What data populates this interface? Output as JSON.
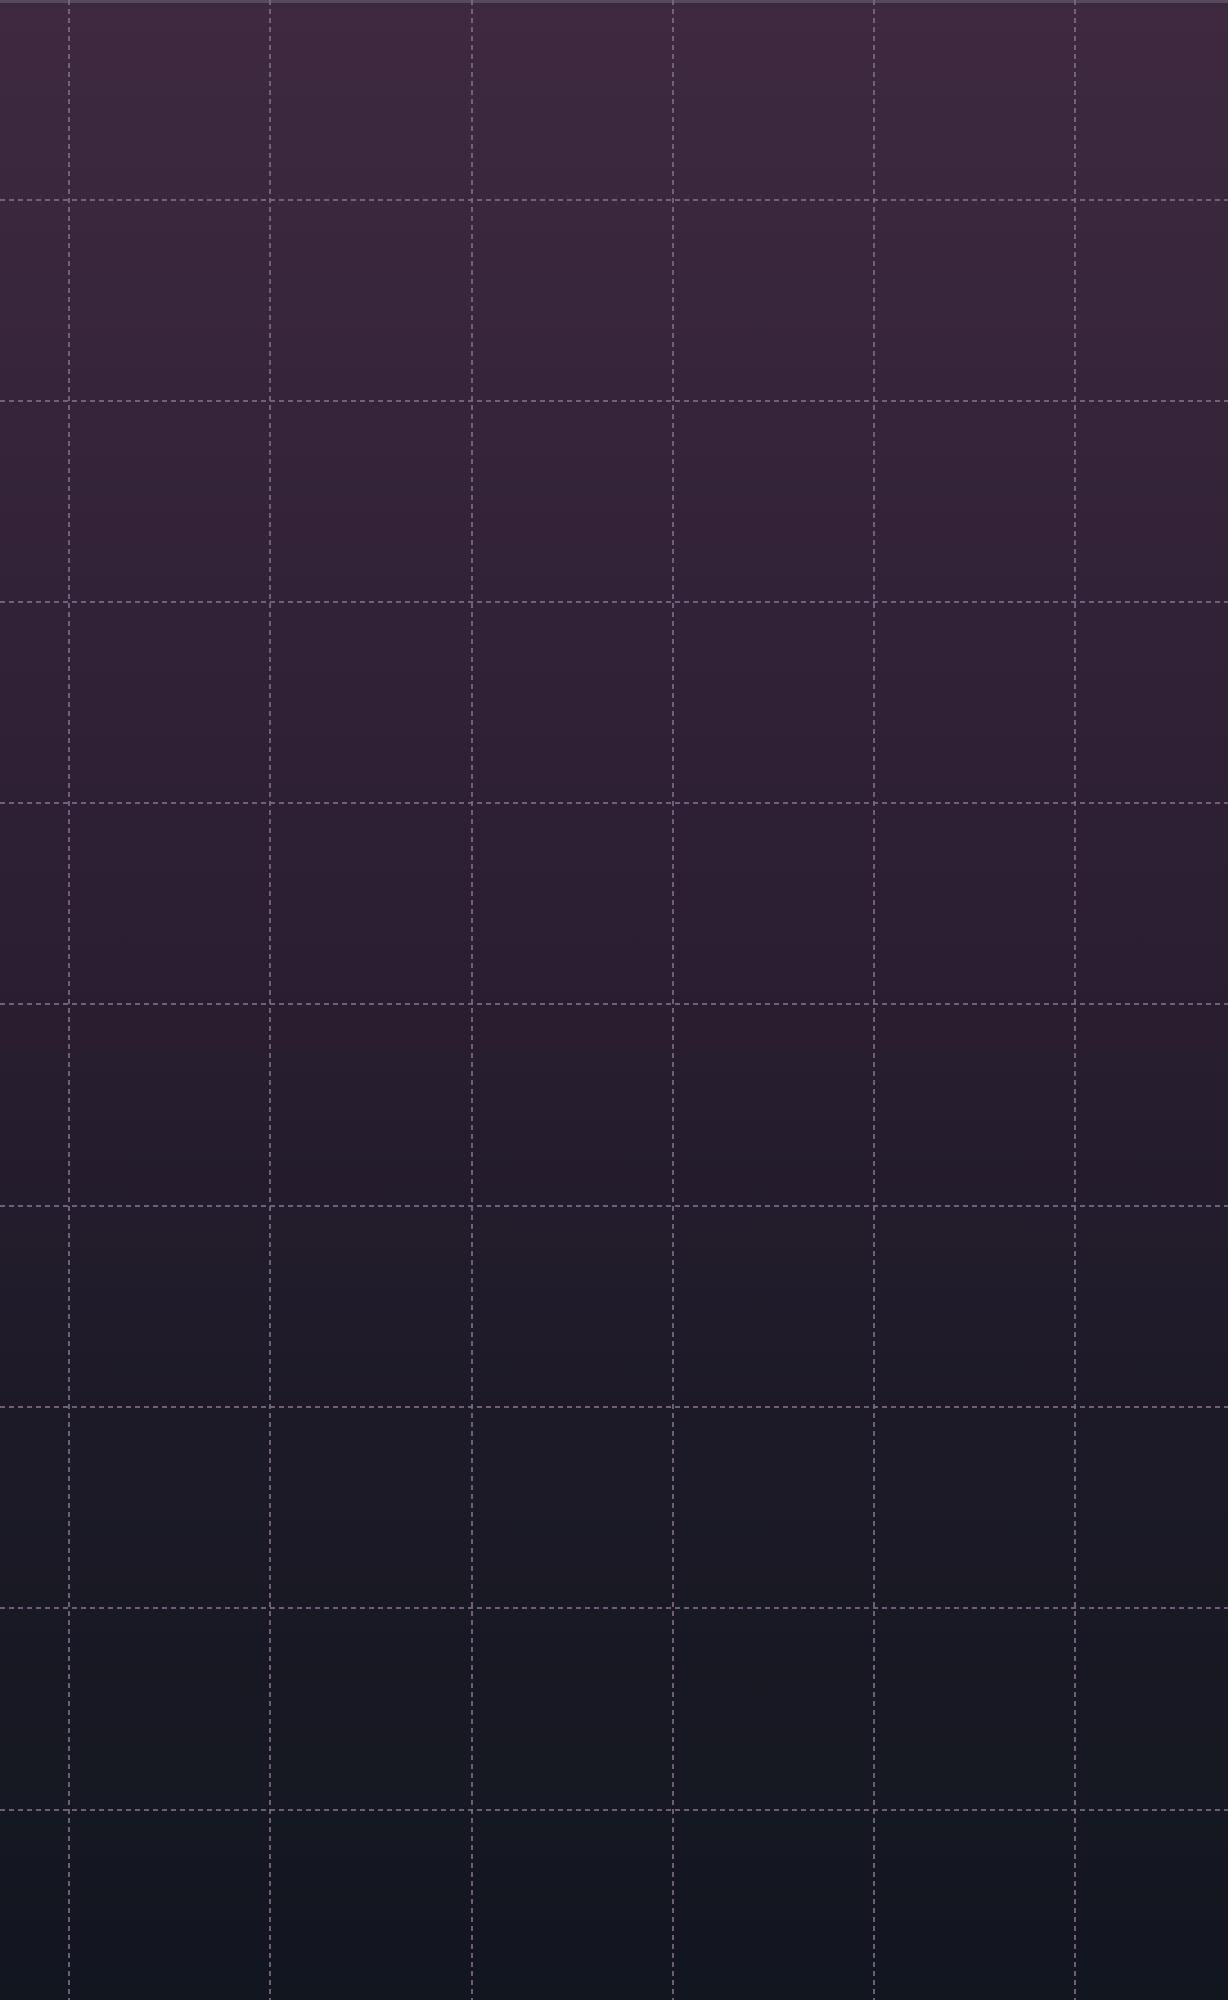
{
  "background": {
    "gradient_top_color": "#3e2940",
    "gradient_bottom_color": "#12161f",
    "grid_line_color": "#7d6b86"
  }
}
